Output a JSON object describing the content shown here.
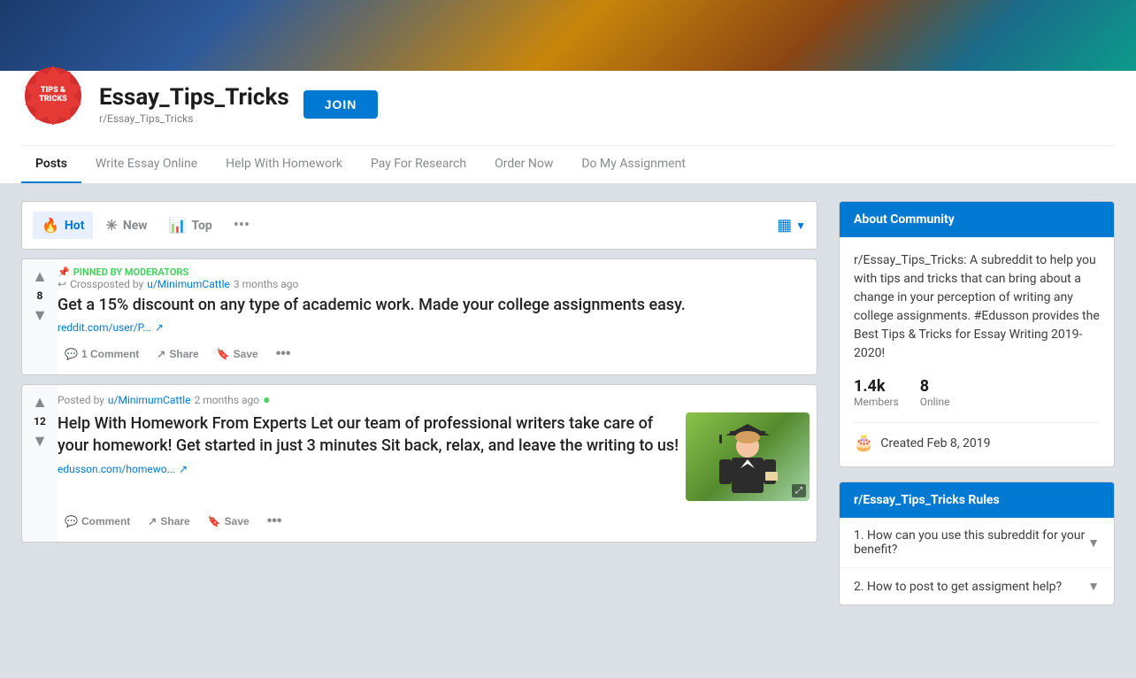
{
  "header": {
    "banner_colors": [
      "#1a3a6b",
      "#2d5a9b",
      "#c8860a",
      "#8b4513",
      "#0d9b8a"
    ],
    "logo_text_line1": "TIPS &",
    "logo_text_line2": "TRICKS",
    "subreddit_name": "Essay_Tips_Tricks",
    "subreddit_handle": "r/Essay_Tips_Tricks",
    "join_label": "JOIN"
  },
  "nav": {
    "tabs": [
      {
        "label": "Posts",
        "active": true
      },
      {
        "label": "Write Essay Online",
        "active": false
      },
      {
        "label": "Help With Homework",
        "active": false
      },
      {
        "label": "Pay For Research",
        "active": false
      },
      {
        "label": "Order Now",
        "active": false
      },
      {
        "label": "Do My Assignment",
        "active": false
      }
    ]
  },
  "sort": {
    "options": [
      {
        "id": "hot",
        "icon": "🔥",
        "label": "Hot",
        "active": true
      },
      {
        "id": "new",
        "icon": "✳",
        "label": "New",
        "active": false
      },
      {
        "id": "top",
        "icon": "📊",
        "label": "Top",
        "active": false
      }
    ],
    "more_icon": "•••"
  },
  "posts": [
    {
      "id": "post1",
      "pinned": true,
      "pinned_label": "PINNED BY MODERATORS",
      "crossposted_by": "u/MinimumCattle",
      "crossposted_ago": "3 months ago",
      "title": "Get a 15% discount on any type of academic work. Made your college assignments easy.",
      "link_text": "reddit.com/user/P...",
      "link_icon": "↗",
      "vote_count": "8",
      "comments_label": "1 Comment",
      "share_label": "Share",
      "save_label": "Save",
      "has_image": false
    },
    {
      "id": "post2",
      "pinned": false,
      "posted_by": "u/MinimumCattle",
      "posted_ago": "2 months ago",
      "title": "Help With Homework From Experts Let our team of professional writers take care of your homework! Get started in just 3 minutes Sit back, relax, and leave the writing to us!",
      "link_text": "edusson.com/homewo...",
      "link_icon": "↗",
      "vote_count": "12",
      "comments_label": "Comment",
      "share_label": "Share",
      "save_label": "Save",
      "has_image": true,
      "image_alt": "Graduate student"
    }
  ],
  "sidebar": {
    "about": {
      "header": "About Community",
      "description": "r/Essay_Tips_Tricks: A subreddit to help you with tips and tricks that can bring about a change in your perception of writing any college assignments. #Edusson provides the Best Tips & Tricks for Essay Writing 2019-2020!",
      "members_value": "1.4k",
      "members_label": "Members",
      "online_value": "8",
      "online_label": "Online",
      "created_label": "Created Feb 8, 2019"
    },
    "rules": {
      "header": "r/Essay_Tips_Tricks Rules",
      "items": [
        {
          "number": "1.",
          "text": "How can you use this subreddit for your benefit?"
        },
        {
          "number": "2.",
          "text": "How to post to get assigment help?"
        }
      ]
    }
  }
}
